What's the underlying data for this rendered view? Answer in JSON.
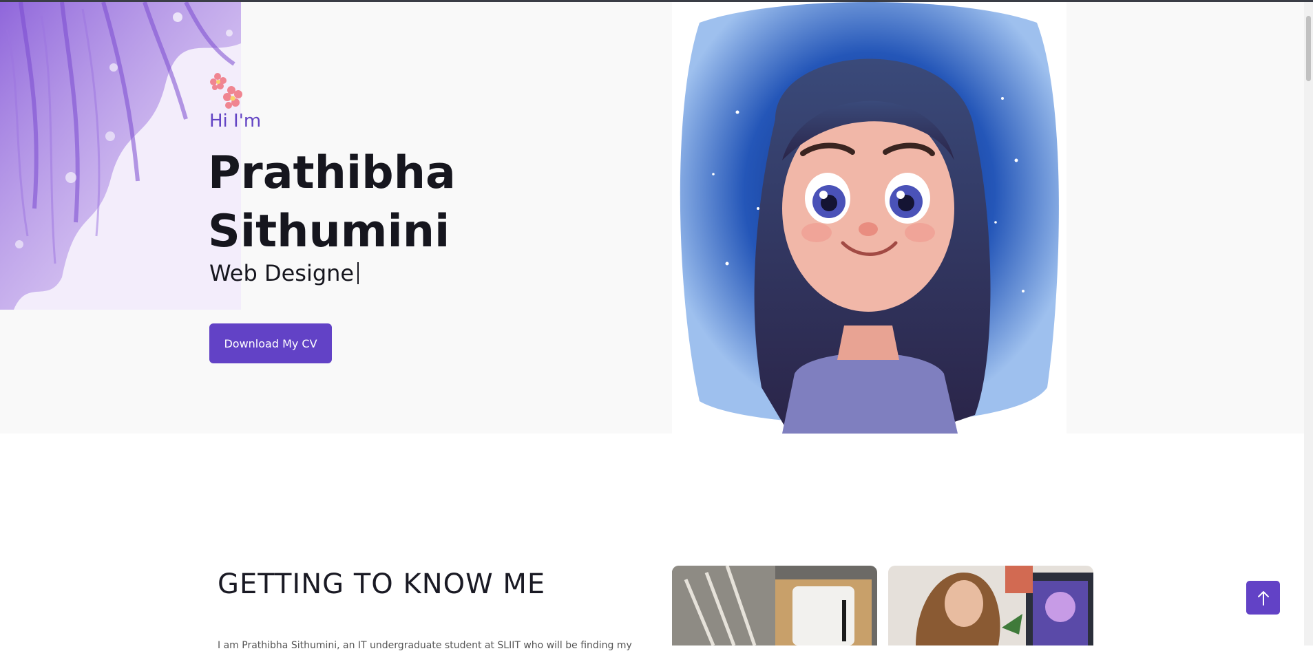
{
  "hero": {
    "greeting": "Hi I'm",
    "first_name": "Prathibha",
    "last_name": "Sithumini",
    "typed_role": "Web Designe",
    "cv_button": "Download My CV"
  },
  "about": {
    "title": "GETTING TO KNOW ME",
    "intro_partial": "I am Prathibha Sithumini, an IT undergraduate student at SLIIT who will be finding my"
  },
  "colors": {
    "accent": "#6242c6",
    "heading": "#16161e",
    "hero_bg": "#f9f9f9"
  },
  "icons": {
    "back_to_top": "arrow-up-icon"
  }
}
